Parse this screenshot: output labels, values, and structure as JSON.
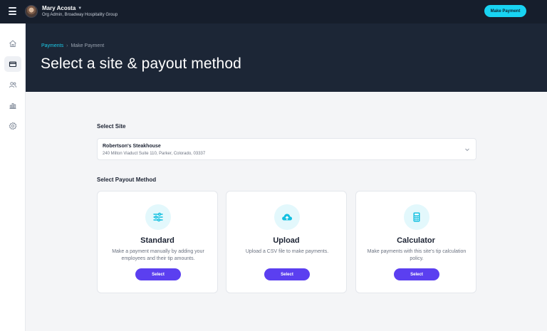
{
  "header": {
    "user_name": "Mary Acosta",
    "user_role": "Org Admin, Broadway Hospitality Group",
    "make_payment_label": "Make Payment"
  },
  "sidebar": {
    "items": [
      {
        "icon": "home-icon",
        "active": false
      },
      {
        "icon": "payments-card-icon",
        "active": true
      },
      {
        "icon": "users-icon",
        "active": false
      },
      {
        "icon": "reports-chart-icon",
        "active": false
      },
      {
        "icon": "settings-gear-icon",
        "active": false
      }
    ]
  },
  "breadcrumb": {
    "parent": "Payments",
    "current": "Make Payment"
  },
  "page_title": "Select a site & payout method",
  "site_section": {
    "label": "Select Site",
    "selected_name": "Robertson's Steakhouse",
    "selected_address": "240 Milton Viaduct Suite 110, Parker, Colorado, 03337"
  },
  "payout_section": {
    "label": "Select Payout Method",
    "methods": [
      {
        "title": "Standard",
        "description": "Make a payment manually by adding your employees and their tip amounts.",
        "button": "Select",
        "icon": "sliders-icon"
      },
      {
        "title": "Upload",
        "description": "Upload a CSV file to make payments.",
        "button": "Select",
        "icon": "cloud-upload-icon"
      },
      {
        "title": "Calculator",
        "description": "Make payments with this site's tip calculation policy.",
        "button": "Select",
        "icon": "calculator-icon"
      }
    ]
  },
  "colors": {
    "topbar": "#161e2c",
    "hero": "#1c2636",
    "accent_cyan": "#18d3f2",
    "button_purple": "#5b3ff0",
    "icon_circle": "#e3f8fc"
  }
}
